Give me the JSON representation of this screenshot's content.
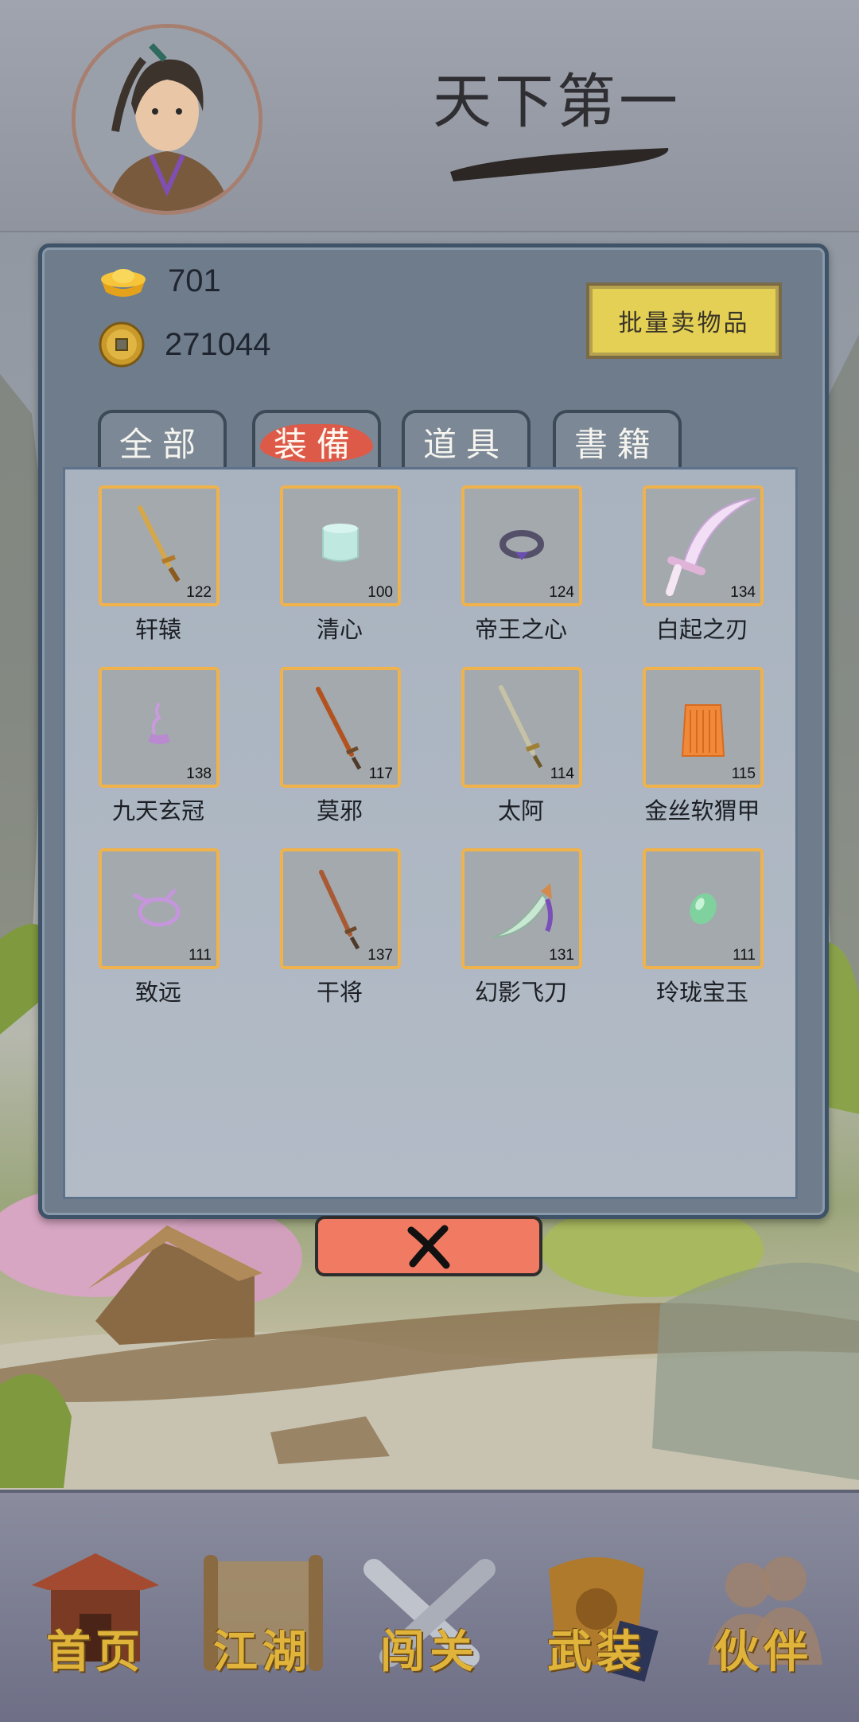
{
  "header": {
    "title": "天下第一"
  },
  "currency": {
    "gold_ingot": "701",
    "coins": "271044"
  },
  "actions": {
    "bulk_sell_label": "批量卖物品"
  },
  "tabs": [
    {
      "label": "全部",
      "active": false
    },
    {
      "label": "装備",
      "active": true
    },
    {
      "label": "道具",
      "active": false
    },
    {
      "label": "書籍",
      "active": false
    }
  ],
  "items": [
    {
      "name": "轩辕",
      "level": "122",
      "icon": "sword-gold-icon"
    },
    {
      "name": "清心",
      "level": "100",
      "icon": "jade-bracelet-icon"
    },
    {
      "name": "帝王之心",
      "level": "124",
      "icon": "ring-icon"
    },
    {
      "name": "白起之刃",
      "level": "134",
      "icon": "curved-blade-icon"
    },
    {
      "name": "九天玄冠",
      "level": "138",
      "icon": "crown-icon"
    },
    {
      "name": "莫邪",
      "level": "117",
      "icon": "sword-bronze-icon"
    },
    {
      "name": "太阿",
      "level": "114",
      "icon": "sword-silver-icon"
    },
    {
      "name": "金丝软猬甲",
      "level": "115",
      "icon": "armor-vest-icon"
    },
    {
      "name": "致远",
      "level": "111",
      "icon": "ribbon-icon"
    },
    {
      "name": "干将",
      "level": "137",
      "icon": "sword-copper-icon"
    },
    {
      "name": "幻影飞刀",
      "level": "131",
      "icon": "flying-knife-icon"
    },
    {
      "name": "玲珑宝玉",
      "level": "111",
      "icon": "jade-gem-icon"
    }
  ],
  "nav": [
    {
      "label": "首页",
      "icon": "pavilion-icon"
    },
    {
      "label": "江湖",
      "icon": "scroll-icon"
    },
    {
      "label": "闯关",
      "icon": "crossed-swords-icon"
    },
    {
      "label": "武装",
      "icon": "armor-book-icon"
    },
    {
      "label": "伙伴",
      "icon": "companions-icon"
    }
  ],
  "colors": {
    "accent": "#e8553f",
    "slot_border": "#f0b24a",
    "nav_text": "#e0b43a"
  }
}
